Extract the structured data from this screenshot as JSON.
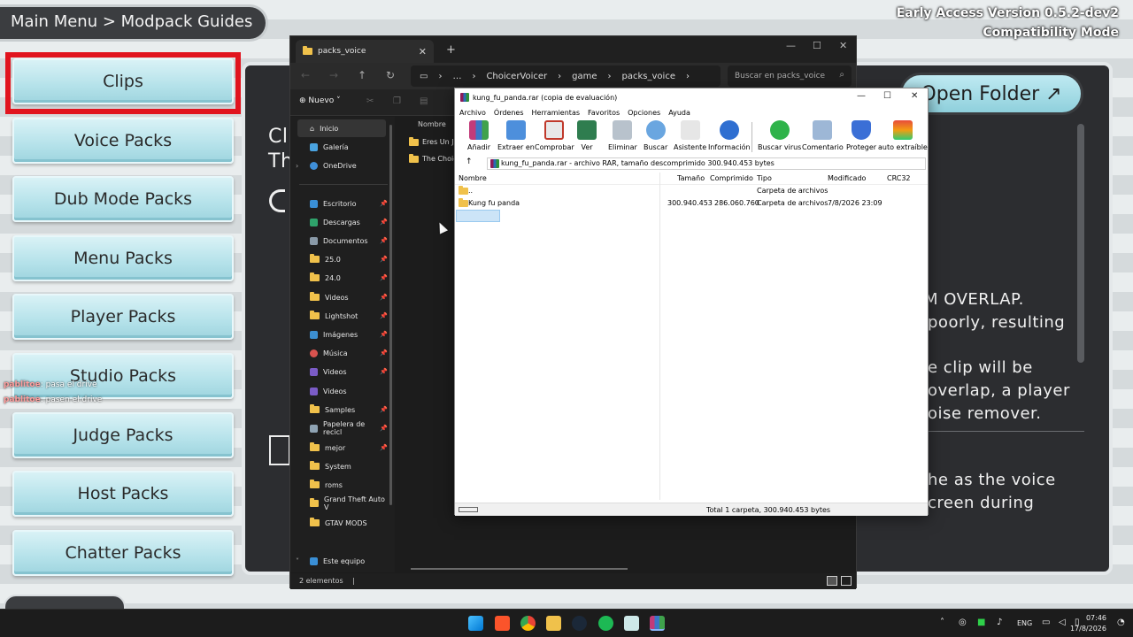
{
  "game": {
    "breadcrumb": "Main Menu > Modpack Guides",
    "version": "Early Access Version 0.5.2-dev2",
    "mode": "Compatibility Mode",
    "menu": [
      "Clips",
      "Voice Packs",
      "Dub Mode Packs",
      "Menu Packs",
      "Player Packs",
      "Studio Packs",
      "Judge Packs",
      "Host Packs",
      "Chatter Packs"
    ],
    "open_folder": "Open Folder ↗",
    "panel_title_1": "Cl",
    "panel_title_2": "Th",
    "text_lines": [
      "M OVERLAP.",
      "poorly, resulting",
      "e clip will be",
      "overlap, a player",
      "oise remover.",
      "he as the voice",
      "creen during"
    ],
    "chat": [
      {
        "user": "pablitoe",
        "msg": ": pasa el drive"
      },
      {
        "user": "pablitoe",
        "msg": ": pasen el drive"
      }
    ]
  },
  "explorer": {
    "tab_title": "packs_voice",
    "breadcrumb": [
      "ChoicerVoicer",
      "game",
      "packs_voice"
    ],
    "search_placeholder": "Buscar en packs_voice",
    "new_label": "Nuevo",
    "column_name": "Nombre",
    "sidebar": [
      {
        "label": "Inicio",
        "icon": "home-icon"
      },
      {
        "label": "Galería",
        "icon": "gallery-icon"
      },
      {
        "label": "OneDrive",
        "icon": "cloud-icon"
      },
      {
        "label": "Escritorio",
        "icon": "desktop-icon"
      },
      {
        "label": "Descargas",
        "icon": "download-icon"
      },
      {
        "label": "Documentos",
        "icon": "document-icon"
      },
      {
        "label": "25.0",
        "icon": "folder-icon"
      },
      {
        "label": "24.0",
        "icon": "folder-icon"
      },
      {
        "label": "Videos",
        "icon": "folder-icon"
      },
      {
        "label": "Lightshot",
        "icon": "folder-icon"
      },
      {
        "label": "Imágenes",
        "icon": "pictures-icon"
      },
      {
        "label": "Música",
        "icon": "music-icon"
      },
      {
        "label": "Videos",
        "icon": "videos-icon"
      },
      {
        "label": "Videos",
        "icon": "videos-icon"
      },
      {
        "label": "Samples",
        "icon": "folder-icon"
      },
      {
        "label": "Papelera de recicl",
        "icon": "recycle-bin-icon"
      },
      {
        "label": "mejor",
        "icon": "folder-icon"
      },
      {
        "label": "System",
        "icon": "folder-icon"
      },
      {
        "label": "roms",
        "icon": "folder-icon"
      },
      {
        "label": "Grand Theft Auto V",
        "icon": "folder-icon"
      },
      {
        "label": "GTAV MODS",
        "icon": "folder-icon"
      },
      {
        "label": "Este equipo",
        "icon": "computer-icon"
      }
    ],
    "files": [
      "Eres Un Ju",
      "The Choic"
    ],
    "status": "2 elementos"
  },
  "winrar": {
    "title": "kung_fu_panda.rar (copia de evaluación)",
    "menu": [
      "Archivo",
      "Órdenes",
      "Herramientas",
      "Favoritos",
      "Opciones",
      "Ayuda"
    ],
    "tools": [
      "Añadir",
      "Extraer en",
      "Comprobar",
      "Ver",
      "Eliminar",
      "Buscar",
      "Asistente",
      "Información",
      "Buscar virus",
      "Comentario",
      "Proteger",
      "auto extraíble"
    ],
    "path": "kung_fu_panda.rar - archivo RAR, tamaño descomprimido 300.940.453 bytes",
    "columns": [
      "Nombre",
      "Tamaño",
      "Comprimido",
      "Tipo",
      "Modificado",
      "CRC32"
    ],
    "rows": [
      {
        "name": "..",
        "size": "",
        "packed": "",
        "type": "Carpeta de archivos",
        "modified": ""
      },
      {
        "name": "Kung fu panda",
        "size": "300.940.453",
        "packed": "286.060.760",
        "type": "Carpeta de archivos",
        "modified": "7/8/2026 23:09"
      }
    ],
    "status": "Total 1 carpeta, 300.940.453 bytes"
  },
  "taskbar": {
    "lang": "ENG",
    "time": "07:46",
    "date": "17/8/2026"
  }
}
